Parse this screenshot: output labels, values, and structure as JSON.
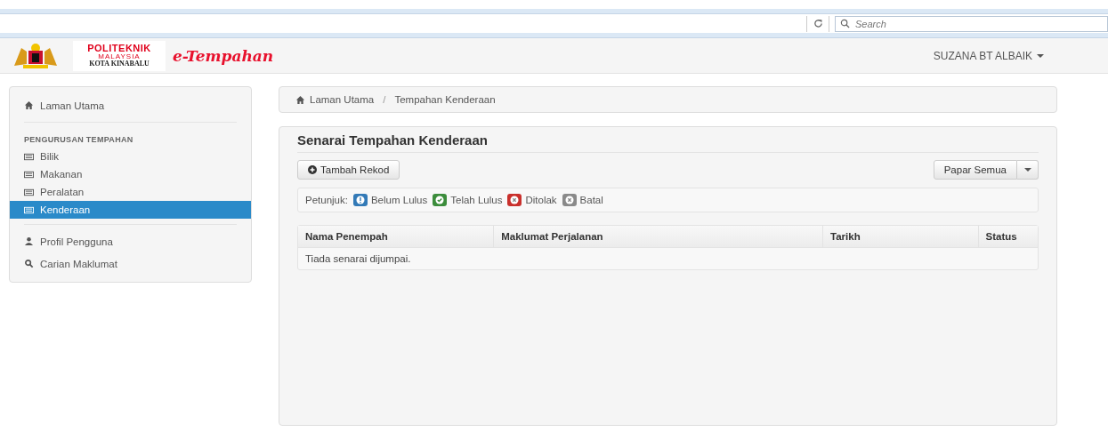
{
  "browser_bar": {
    "search": {
      "placeholder": "Search"
    }
  },
  "navbar": {
    "logo": {
      "title": "POLITEKNIK",
      "subtitle": "MALAYSIA",
      "campus": "KOTA KINABALU"
    },
    "app_name": "e-Tempahan",
    "user": "SUZANA BT ALBAIK"
  },
  "sidebar": {
    "items": [
      {
        "kind": "home",
        "label": "Laman Utama",
        "selected": false
      },
      {
        "kind": "divider"
      },
      {
        "kind": "header",
        "label": "PENGURUSAN TEMPAHAN"
      },
      {
        "kind": "booking",
        "label": "Bilik",
        "selected": false
      },
      {
        "kind": "booking",
        "label": "Makanan",
        "selected": false
      },
      {
        "kind": "booking",
        "label": "Peralatan",
        "selected": false
      },
      {
        "kind": "booking",
        "label": "Kenderaan",
        "selected": true
      },
      {
        "kind": "divider"
      },
      {
        "kind": "profile",
        "label": "Profil Pengguna",
        "selected": false
      },
      {
        "kind": "search",
        "label": "Carian Maklumat",
        "selected": false
      }
    ]
  },
  "breadcrumb": {
    "separator": "/",
    "items": [
      "Laman Utama",
      "Tempahan Kenderaan"
    ]
  },
  "panel": {
    "title": "Senarai Tempahan Kenderaan",
    "add_button": "Tambah Rekod",
    "filter_button": "Papar Semua",
    "legend": {
      "label": "Petunjuk:",
      "items": [
        {
          "kind": "pending",
          "label": "Belum Lulus",
          "color": "#337ab7"
        },
        {
          "kind": "approved",
          "label": "Telah Lulus",
          "color": "#3c8d3c"
        },
        {
          "kind": "rejected",
          "label": "Ditolak",
          "color": "#c9302c"
        },
        {
          "kind": "cancelled",
          "label": "Batal",
          "color": "#8a8a8a"
        }
      ]
    },
    "table": {
      "columns": [
        "Nama Penempah",
        "Maklumat Perjalanan",
        "Tarikh",
        "Status"
      ],
      "empty_message": "Tiada senarai dijumpai."
    }
  }
}
